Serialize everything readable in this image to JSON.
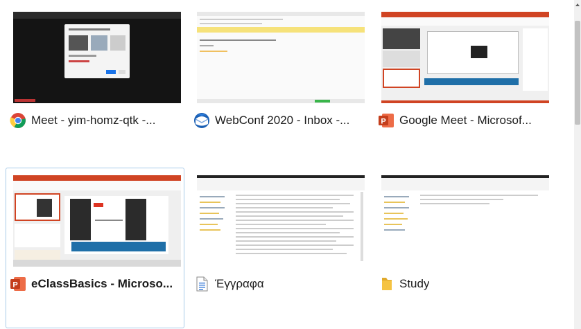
{
  "windows": [
    {
      "title": "Meet - yim-homz-qtk -...",
      "icon": "chrome-icon",
      "selected": false
    },
    {
      "title": "WebConf 2020 - Inbox -...",
      "icon": "thunderbird-icon",
      "selected": false
    },
    {
      "title": "Google Meet - Microsof...",
      "icon": "powerpoint-icon",
      "selected": false
    },
    {
      "title": "eClassBasics - Microso...",
      "icon": "powerpoint-icon",
      "selected": true
    },
    {
      "title": "Έγγραφα",
      "icon": "document-icon",
      "selected": false
    },
    {
      "title": "Study",
      "icon": "folder-icon",
      "selected": false
    }
  ],
  "colors": {
    "selection_border": "#a8cbe9",
    "powerpoint_red": "#d04423",
    "folder_yellow": "#f5c342",
    "meet_dark": "#141414"
  }
}
